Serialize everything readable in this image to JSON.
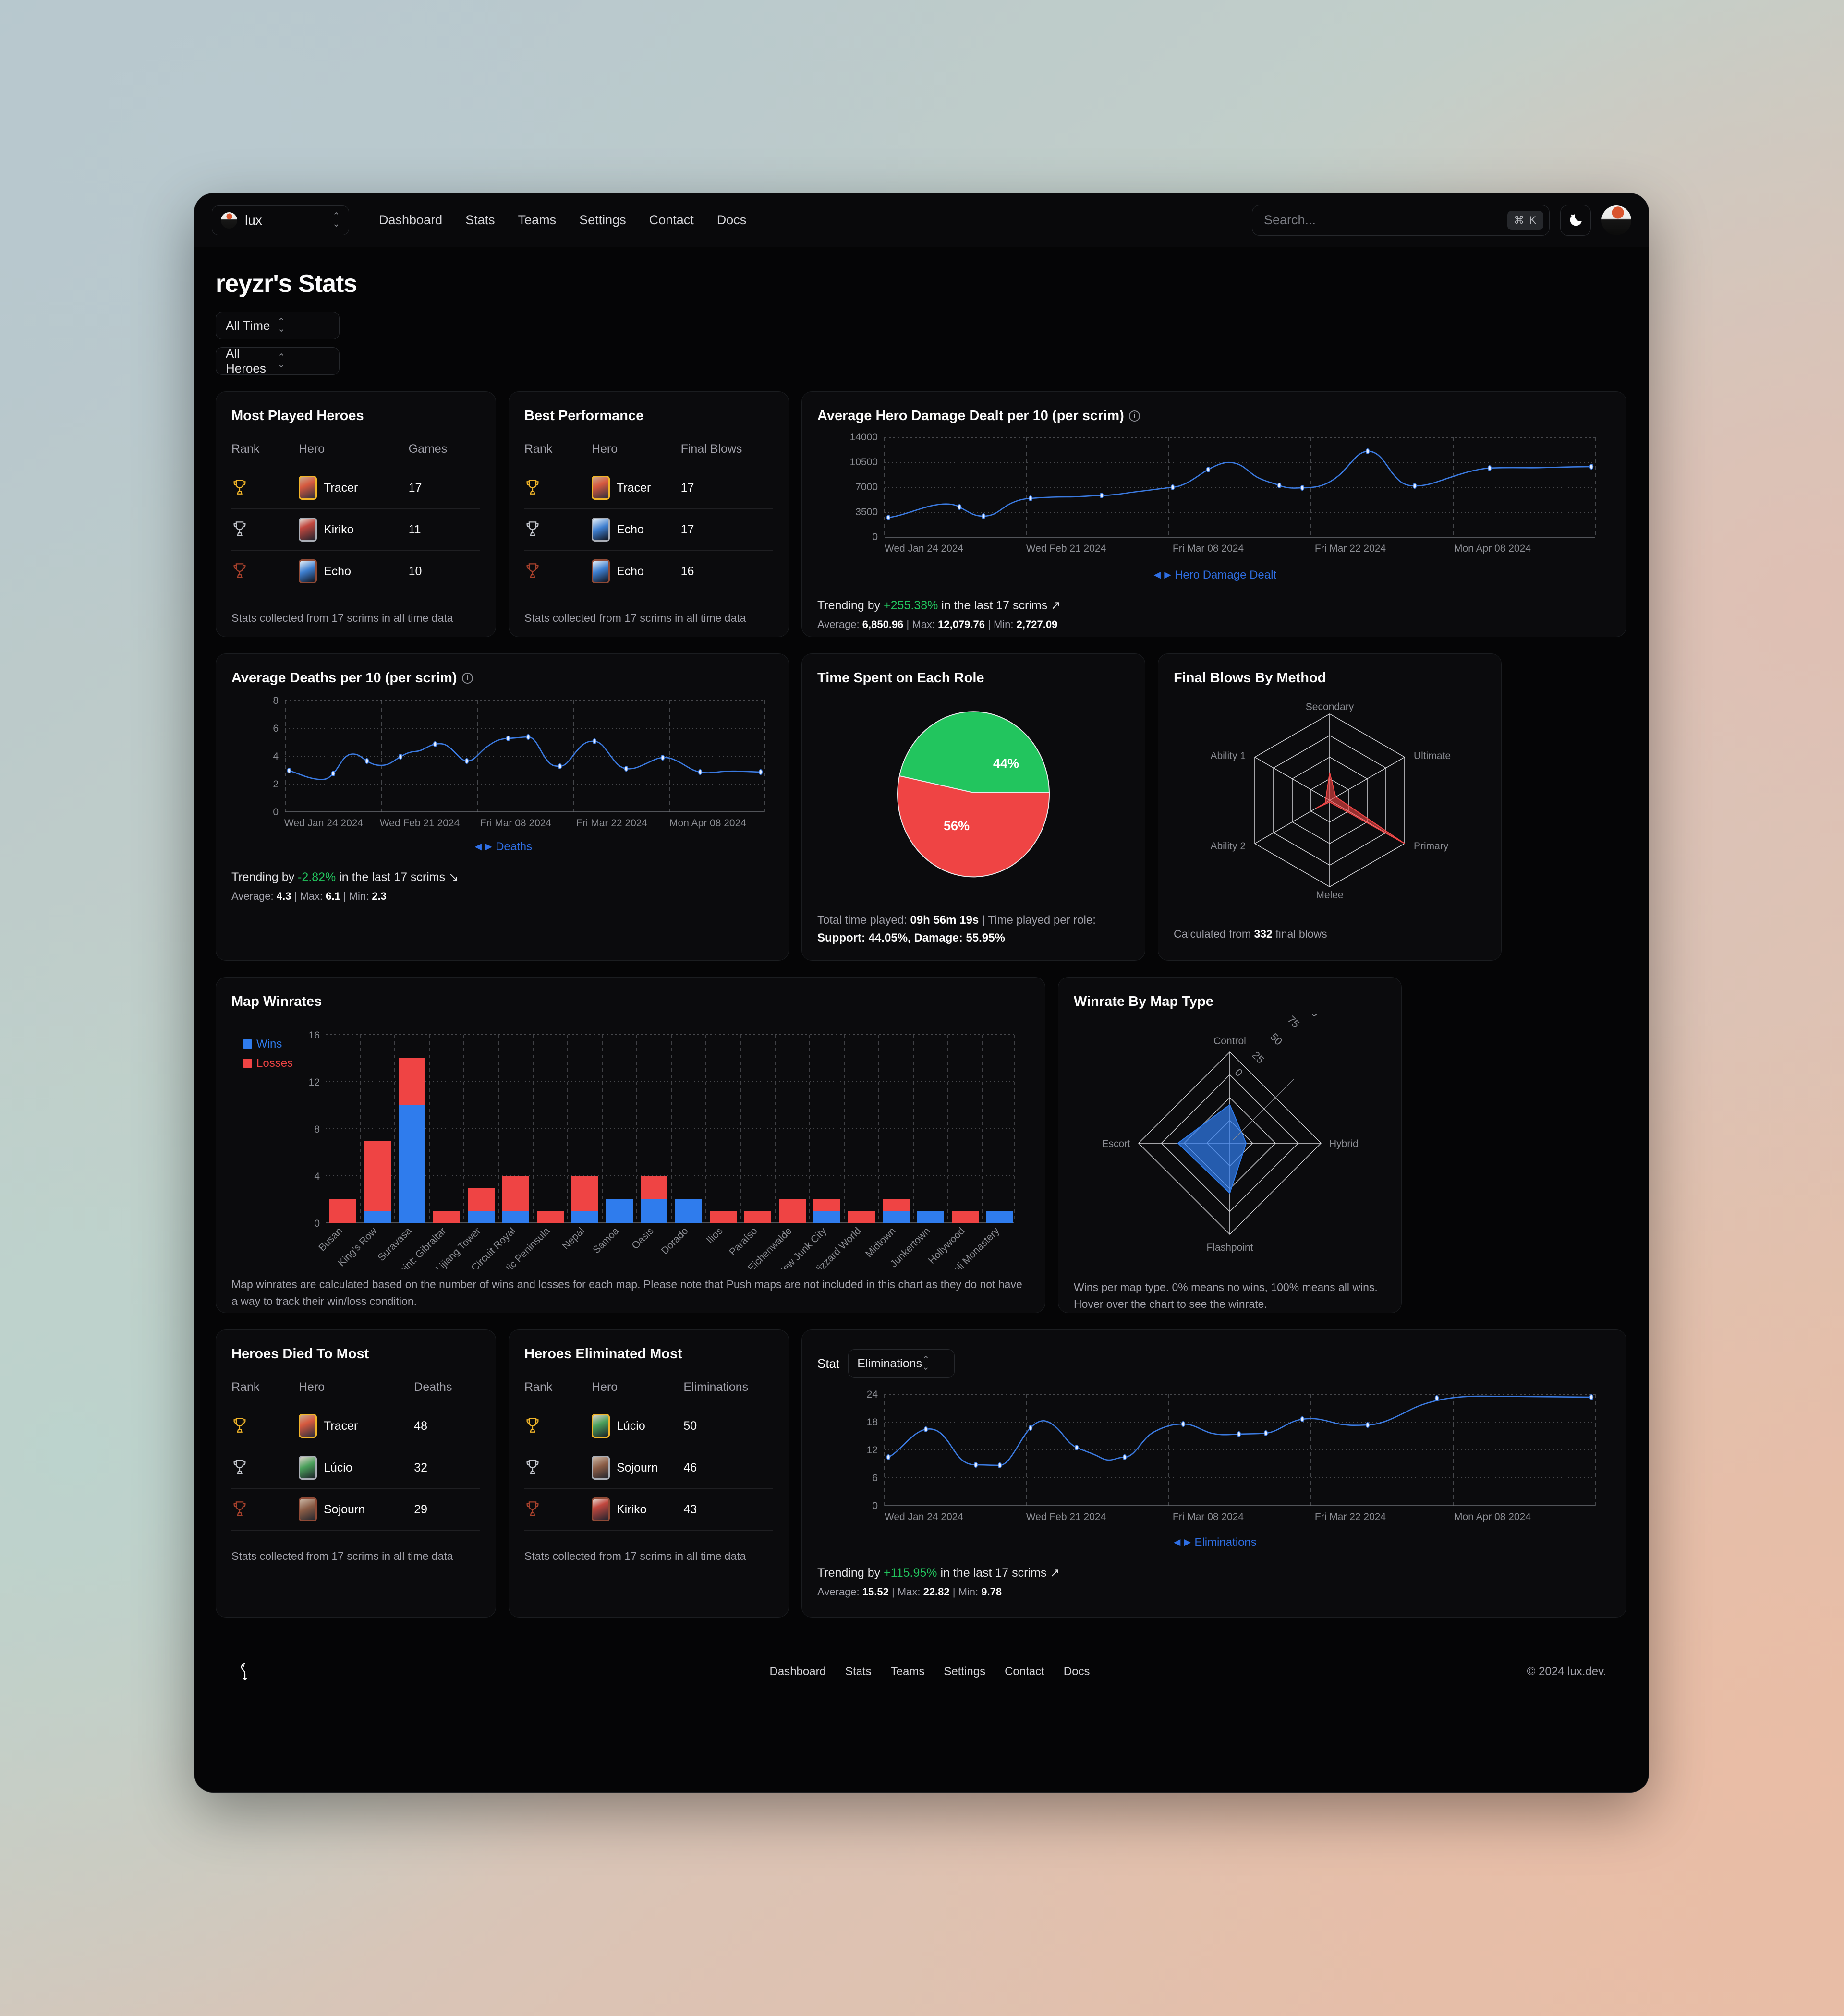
{
  "nav": {
    "team": "lux",
    "links": [
      "Dashboard",
      "Stats",
      "Teams",
      "Settings",
      "Contact",
      "Docs"
    ],
    "search_placeholder": "Search...",
    "search_kbd": "⌘ K",
    "theme_icon": "moon-icon"
  },
  "page": {
    "title": "reyzr's Stats",
    "filter_time": "All Time",
    "filter_heroes": "All Heroes"
  },
  "most_played": {
    "title": "Most Played Heroes",
    "columns": [
      "Rank",
      "Hero",
      "Games"
    ],
    "rows": [
      {
        "rank": "gold",
        "hero": "Tracer",
        "value": "17"
      },
      {
        "rank": "silver",
        "hero": "Kiriko",
        "value": "11"
      },
      {
        "rank": "bronze",
        "hero": "Echo",
        "value": "10"
      }
    ],
    "note": "Stats collected from 17 scrims in all time data"
  },
  "best_performance": {
    "title": "Best Performance",
    "columns": [
      "Rank",
      "Hero",
      "Final Blows"
    ],
    "rows": [
      {
        "rank": "gold",
        "hero": "Tracer",
        "value": "17"
      },
      {
        "rank": "silver",
        "hero": "Echo",
        "value": "17"
      },
      {
        "rank": "bronze",
        "hero": "Echo",
        "value": "16"
      }
    ],
    "note": "Stats collected from 17 scrims in all time data"
  },
  "damage_chart": {
    "title": "Average Hero Damage Dealt per 10 (per scrim)",
    "legend": "Hero Damage Dealt",
    "trend_prefix": "Trending by ",
    "trend_value": "+255.38%",
    "trend_suffix": " in the last 17 scrims ",
    "trend_arrow": "↗",
    "stats": {
      "avg_label": "Average: ",
      "avg": "6,850.96",
      "max_label": " | Max: ",
      "max": "12,079.76",
      "min_label": " | Min: ",
      "min": "2,727.09"
    }
  },
  "deaths_chart": {
    "title": "Average Deaths per 10 (per scrim)",
    "legend": "Deaths",
    "trend_prefix": "Trending by ",
    "trend_value": "-2.82%",
    "trend_suffix": " in the last 17 scrims ",
    "trend_arrow": "↘",
    "stats": {
      "avg_label": "Average: ",
      "avg": "4.3",
      "max_label": " | Max: ",
      "max": "6.1",
      "min_label": " | Min: ",
      "min": "2.3"
    }
  },
  "role_pie": {
    "title": "Time Spent on Each Role",
    "note_a": "Total time played: ",
    "note_total": "09h 56m 19s",
    "note_b": " | Time played per role: ",
    "note_roles": "Support: 44.05%, Damage: 55.95%"
  },
  "final_blows": {
    "title": "Final Blows By Method",
    "note_a": "Calculated from ",
    "note_count": "332",
    "note_b": " final blows"
  },
  "map_winrates": {
    "title": "Map Winrates",
    "legend": [
      "Wins",
      "Losses"
    ],
    "note": "Map winrates are calculated based on the number of wins and losses for each map. Please note that Push maps are not included in this chart as they do not have a way to track their win/loss condition."
  },
  "winrate_map_type": {
    "title": "Winrate By Map Type",
    "note": "Wins per map type. 0% means no wins, 100% means all wins. Hover over the chart to see the winrate."
  },
  "died_to_most": {
    "title": "Heroes Died To Most",
    "columns": [
      "Rank",
      "Hero",
      "Deaths"
    ],
    "rows": [
      {
        "rank": "gold",
        "hero": "Tracer",
        "value": "48"
      },
      {
        "rank": "silver",
        "hero": "Lúcio",
        "value": "32"
      },
      {
        "rank": "bronze",
        "hero": "Sojourn",
        "value": "29"
      }
    ],
    "note": "Stats collected from 17 scrims in all time data"
  },
  "eliminated_most": {
    "title": "Heroes Eliminated Most",
    "columns": [
      "Rank",
      "Hero",
      "Eliminations"
    ],
    "rows": [
      {
        "rank": "gold",
        "hero": "Lúcio",
        "value": "50"
      },
      {
        "rank": "silver",
        "hero": "Sojourn",
        "value": "46"
      },
      {
        "rank": "bronze",
        "hero": "Kiriko",
        "value": "43"
      }
    ],
    "note": "Stats collected from 17 scrims in all time data"
  },
  "elims_chart": {
    "stat_label": "Stat",
    "stat_value": "Eliminations",
    "legend": "Eliminations",
    "trend_prefix": "Trending by ",
    "trend_value": "+115.95%",
    "trend_suffix": " in the last 17 scrims ",
    "trend_arrow": "↗",
    "stats": {
      "avg_label": "Average: ",
      "avg": "15.52",
      "max_label": " | Max: ",
      "max": "22.82",
      "min_label": " | Min: ",
      "min": "9.78"
    }
  },
  "footer": {
    "links": [
      "Dashboard",
      "Stats",
      "Teams",
      "Settings",
      "Contact",
      "Docs"
    ],
    "copyright": "© 2024 lux.dev."
  },
  "colors": {
    "blue": "#2f6fe4",
    "line_blue": "#3b7ae0",
    "red": "#ef4444",
    "green": "#22c55e",
    "wins": "#2f7ced",
    "losses": "#ef4444"
  },
  "chart_data": [
    {
      "type": "line",
      "id": "hero_damage",
      "title": "Average Hero Damage Dealt per 10 (per scrim)",
      "ylabel": "",
      "xlabel": "",
      "ylim": [
        0,
        14000
      ],
      "yticks": [
        0,
        3500,
        7000,
        10500,
        14000
      ],
      "xticks": [
        "Wed Jan 24 2024",
        "Wed Feb 21 2024",
        "Fri Mar 08 2024",
        "Fri Mar 22 2024",
        "Mon Apr 08 2024"
      ],
      "series": [
        {
          "name": "Hero Damage Dealt",
          "values": [
            2727,
            4450,
            3400,
            4700,
            5950,
            6050,
            6300,
            6950,
            10200,
            8550,
            7250,
            12080,
            7550,
            9800
          ]
        }
      ],
      "grid": true,
      "legend": "bottom"
    },
    {
      "type": "line",
      "id": "deaths",
      "title": "Average Deaths per 10 (per scrim)",
      "ylim": [
        0,
        8
      ],
      "yticks": [
        0,
        2,
        4,
        6,
        8
      ],
      "xticks": [
        "Wed Jan 24 2024",
        "Wed Feb 21 2024",
        "Fri Mar 08 2024",
        "Fri Mar 22 2024",
        "Mon Apr 08 2024"
      ],
      "series": [
        {
          "name": "Deaths",
          "values": [
            2.95,
            2.3,
            4.35,
            3.8,
            4.65,
            5.45,
            4.75,
            5.9,
            6.1,
            3.9,
            5.6,
            3.65,
            4.15,
            2.85
          ]
        }
      ],
      "grid": true,
      "legend": "bottom"
    },
    {
      "type": "pie",
      "id": "role_time",
      "title": "Time Spent on Each Role",
      "labels": [
        "Support",
        "Damage"
      ],
      "values": [
        44.05,
        55.95
      ],
      "display_labels": [
        "44%",
        "56%"
      ],
      "colors": [
        "#22c55e",
        "#ef4444"
      ]
    },
    {
      "type": "radar",
      "id": "final_blows_method",
      "title": "Final Blows By Method",
      "axes": [
        "Secondary",
        "Ultimate",
        "Primary",
        "Melee",
        "Ability 2",
        "Ability 1"
      ],
      "values": [
        32,
        8,
        100,
        2,
        18,
        6
      ],
      "max": 100,
      "color": "#ef4444"
    },
    {
      "type": "bar",
      "id": "map_winrates",
      "title": "Map Winrates",
      "ylim": [
        0,
        16
      ],
      "yticks": [
        0,
        4,
        8,
        12,
        16
      ],
      "stacked": true,
      "categories": [
        "Busan",
        "King's Row",
        "Suravasa",
        "Watchpoint: Gibraltar",
        "Lijiang Tower",
        "Circuit Royal",
        "Antarctic Peninsula",
        "Nepal",
        "Samoa",
        "Oasis",
        "Dorado",
        "Ilios",
        "Paraíso",
        "Eichenwalde",
        "New Junk City",
        "Blizzard World",
        "Midtown",
        "Junkertown",
        "Hollywood",
        "Shambali Monastery"
      ],
      "series": [
        {
          "name": "Wins",
          "values": [
            0,
            1,
            10,
            0,
            1,
            1,
            0,
            1,
            2,
            2,
            2,
            0,
            0,
            0,
            1,
            0,
            1,
            1,
            0,
            1
          ]
        },
        {
          "name": "Losses",
          "values": [
            2,
            6,
            4,
            1,
            2,
            3,
            1,
            3,
            0,
            2,
            0,
            1,
            1,
            2,
            1,
            1,
            1,
            0,
            1,
            0
          ]
        }
      ],
      "colors": {
        "Wins": "#2f7ced",
        "Losses": "#ef4444"
      }
    },
    {
      "type": "radar",
      "id": "winrate_map_type",
      "title": "Winrate By Map Type",
      "axes": [
        "Control",
        "Hybrid",
        "Flashpoint",
        "Escort"
      ],
      "ticks": [
        "0",
        "25",
        "50",
        "75",
        "100"
      ],
      "values": [
        42,
        18,
        55,
        57
      ],
      "max": 100,
      "color": "#2f7ced"
    },
    {
      "type": "line",
      "id": "eliminations",
      "title": "Eliminations",
      "ylim": [
        0,
        24
      ],
      "yticks": [
        0,
        6,
        12,
        18,
        24
      ],
      "xticks": [
        "Wed Jan 24 2024",
        "Wed Feb 21 2024",
        "Fri Mar 08 2024",
        "Fri Mar 22 2024",
        "Mon Apr 08 2024"
      ],
      "series": [
        {
          "name": "Eliminations",
          "values": [
            10.5,
            16.9,
            9.8,
            9.7,
            17.6,
            14.8,
            10.6,
            14.9,
            18.2,
            16.6,
            16.9,
            19.4,
            18.3,
            23.6
          ]
        }
      ],
      "grid": true,
      "legend": "bottom"
    }
  ]
}
